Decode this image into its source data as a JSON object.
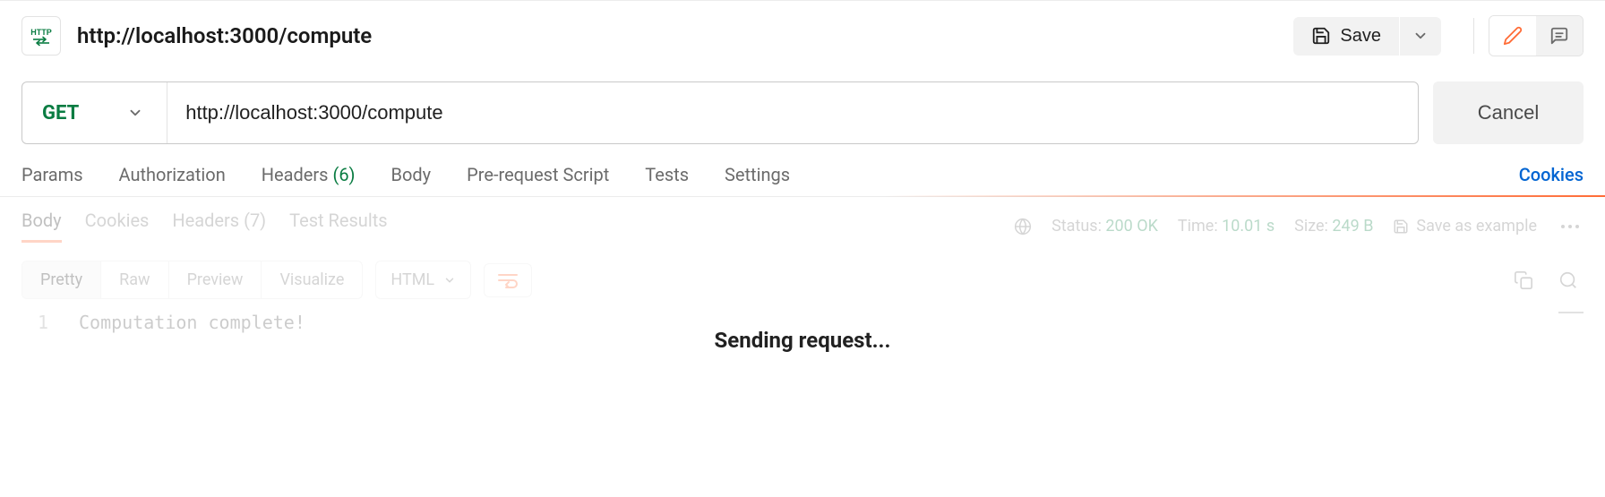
{
  "header": {
    "title": "http://localhost:3000/compute",
    "save_label": "Save"
  },
  "request": {
    "method": "GET",
    "url": "http://localhost:3000/compute",
    "cancel_label": "Cancel"
  },
  "request_tabs": {
    "params": "Params",
    "authorization": "Authorization",
    "headers_label": "Headers",
    "headers_count": "(6)",
    "body": "Body",
    "pre_request_script": "Pre-request Script",
    "tests": "Tests",
    "settings": "Settings",
    "cookies_link": "Cookies"
  },
  "response_tabs": {
    "body": "Body",
    "cookies": "Cookies",
    "headers_label": "Headers",
    "headers_count": "(7)",
    "test_results": "Test Results"
  },
  "response_meta": {
    "status_label": "Status:",
    "status_value": "200 OK",
    "time_label": "Time:",
    "time_value": "10.01 s",
    "size_label": "Size:",
    "size_value": "249 B",
    "save_as_example": "Save as example"
  },
  "view_tabs": {
    "pretty": "Pretty",
    "raw": "Raw",
    "preview": "Preview",
    "visualize": "Visualize"
  },
  "format_select": "HTML",
  "code": {
    "line_number": "1",
    "line_text": "Computation complete!"
  },
  "overlay": {
    "sending": "Sending request..."
  }
}
